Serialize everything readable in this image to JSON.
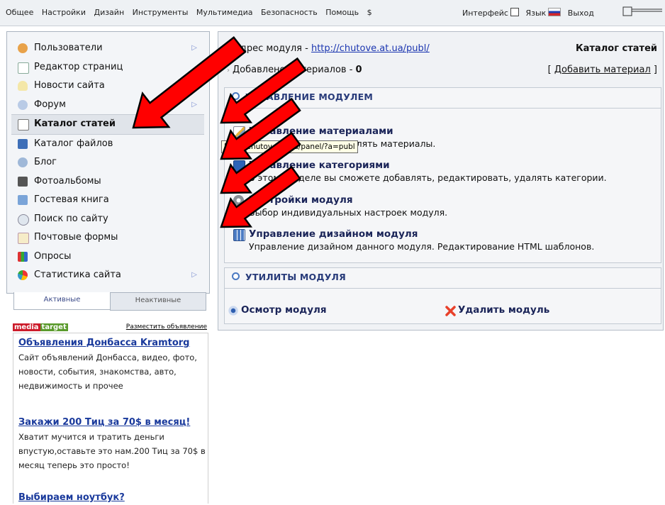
{
  "top_menu": {
    "items": [
      "Общее",
      "Настройки",
      "Дизайн",
      "Инструменты",
      "Мультимедиа",
      "Безопасность",
      "Помощь",
      "$"
    ],
    "interface_label": "Интерфейс",
    "language_label": "Язык",
    "logout_label": "Выход"
  },
  "sidebar": {
    "items": [
      {
        "label": "Пользователи",
        "icon": "users-icon",
        "has_submenu": true
      },
      {
        "label": "Редактор страниц",
        "icon": "page-editor-icon",
        "has_submenu": false
      },
      {
        "label": "Новости сайта",
        "icon": "news-icon",
        "has_submenu": false
      },
      {
        "label": "Форум",
        "icon": "forum-icon",
        "has_submenu": true
      },
      {
        "label": "Каталог статей",
        "icon": "articles-icon",
        "has_submenu": false,
        "active": true
      },
      {
        "label": "Каталог файлов",
        "icon": "files-icon",
        "has_submenu": false
      },
      {
        "label": "Блог",
        "icon": "blog-icon",
        "has_submenu": false
      },
      {
        "label": "Фотоальбомы",
        "icon": "camera-icon",
        "has_submenu": false
      },
      {
        "label": "Гостевая книга",
        "icon": "guestbook-icon",
        "has_submenu": false
      },
      {
        "label": "Поиск по сайту",
        "icon": "search-icon",
        "has_submenu": false
      },
      {
        "label": "Почтовые формы",
        "icon": "mail-icon",
        "has_submenu": false
      },
      {
        "label": "Опросы",
        "icon": "polls-icon",
        "has_submenu": false
      },
      {
        "label": "Статистика сайта",
        "icon": "stats-icon",
        "has_submenu": true
      }
    ],
    "tabs": [
      "Активные",
      "Неактивные"
    ]
  },
  "ads": {
    "logo_part1": "media",
    "logo_part2": "target",
    "place_link": "Разместить объявление",
    "items": [
      {
        "title": "Объявления Донбасса Kramtorg",
        "text": "Сайт объявлений Донбасса, видео, фото, новости, события, знакомства, авто, недвижимость и прочее"
      },
      {
        "title": "Закажи 200 Тиц за 70$ в месяц!",
        "text": "Хватит мучится и тратить деньги впустую,оставьте это нам.200 Тиц за 70$ в месяц теперь это просто!"
      },
      {
        "title": "Выбираем ноутбук?",
        "text": ""
      }
    ]
  },
  "module": {
    "address_label": "Адрес модуля - ",
    "address_url": "http://chutove.at.ua/publ/",
    "added_label": "Добавлено материалов - ",
    "added_count": "0",
    "title": "Каталог статей",
    "add_bracket_open": "[ ",
    "add_link": "Добавить материал",
    "add_bracket_close": " ]"
  },
  "management": {
    "title": "УПРАВЛЕНИЕ МОДУЛЕМ",
    "items": [
      {
        "title": "Управление материалами",
        "desc": "е редактировать и удалять материалы.",
        "icon": "edit-materials-icon"
      },
      {
        "title": "Управление категориями",
        "desc": "В этом разделе вы сможете добавлять, редактировать, удалять категории.",
        "icon": "categories-icon"
      },
      {
        "title": "Настройки модуля",
        "desc": "Выбор индивидуальных настроек модуля.",
        "icon": "gear-icon"
      },
      {
        "title": "Управление дизайном модуля",
        "desc": "Управление дизайном данного модуля. Редактирование HTML шаблонов.",
        "icon": "design-icon"
      }
    ],
    "tooltip": "http://chutove.at.ua/panel/?a=publ"
  },
  "utilities": {
    "title": "УТИЛИТЫ МОДУЛЯ",
    "view_label": "Осмотр модуля",
    "delete_label": "Удалить модуль"
  },
  "colors": {
    "accent_blue": "#1a2458",
    "link_blue": "#1a35b0",
    "arrow_red": "#ff0000",
    "panel_bg": "#f0f2f5"
  }
}
